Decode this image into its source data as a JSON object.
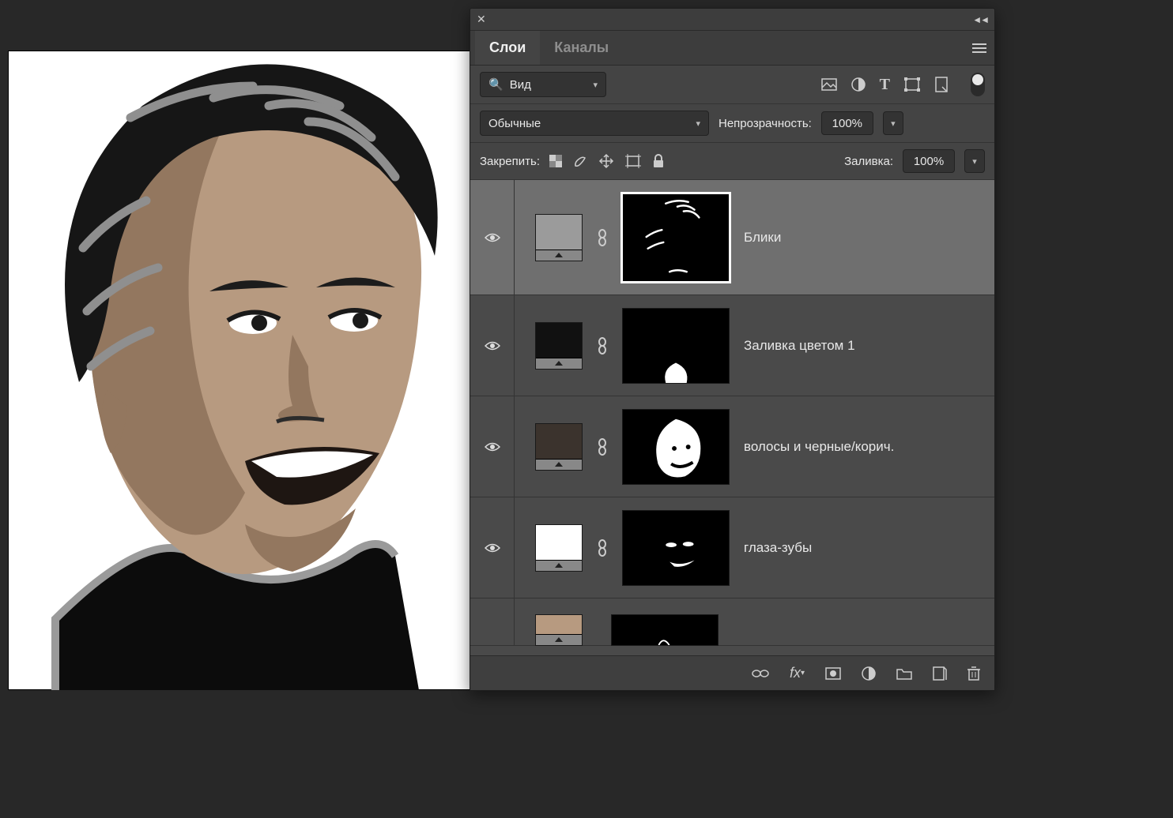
{
  "tabs": {
    "layers": "Слои",
    "channels": "Каналы"
  },
  "filter": {
    "kind_label": "Вид"
  },
  "blend": {
    "mode": "Обычные",
    "opacity_label": "Непрозрачность:",
    "opacity_value": "100%"
  },
  "lock": {
    "label": "Закрепить:",
    "fill_label": "Заливка:",
    "fill_value": "100%"
  },
  "layers": [
    {
      "name": "Блики",
      "swatch": "#9b9b9b",
      "selected": true
    },
    {
      "name": "Заливка цветом 1",
      "swatch": "#111111",
      "selected": false
    },
    {
      "name": "волосы и черные/корич.",
      "swatch": "#3b332d",
      "selected": false
    },
    {
      "name": "глаза-зубы",
      "swatch": "#ffffff",
      "selected": false
    }
  ],
  "icons": {
    "image": "image-filter-icon",
    "adjust": "adjustment-filter-icon",
    "type": "type-filter-icon",
    "shape": "shape-filter-icon",
    "smart": "smart-filter-icon",
    "lock_trans": "lock-transparency-icon",
    "lock_paint": "lock-paint-icon",
    "lock_move": "lock-move-icon",
    "lock_artboard": "lock-artboard-icon",
    "lock_all": "lock-all-icon"
  }
}
